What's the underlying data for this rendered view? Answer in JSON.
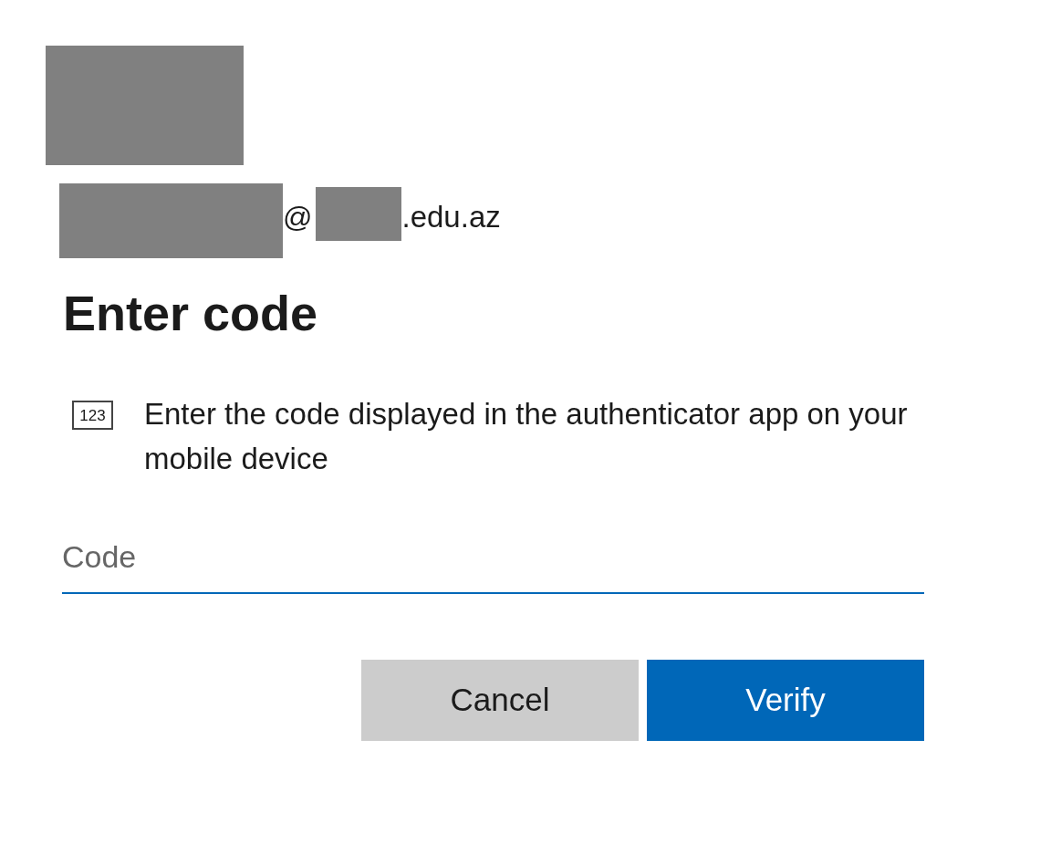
{
  "account": {
    "at_sign": "@",
    "domain": ".edu.az"
  },
  "title": "Enter code",
  "instruction": {
    "text": "Enter the code displayed in the authenticator app on your mobile device",
    "icon_text": "123"
  },
  "code_field": {
    "placeholder": "Code"
  },
  "buttons": [
    {
      "label": "Cancel",
      "kind": "secondary"
    },
    {
      "label": "Verify",
      "kind": "primary"
    }
  ]
}
